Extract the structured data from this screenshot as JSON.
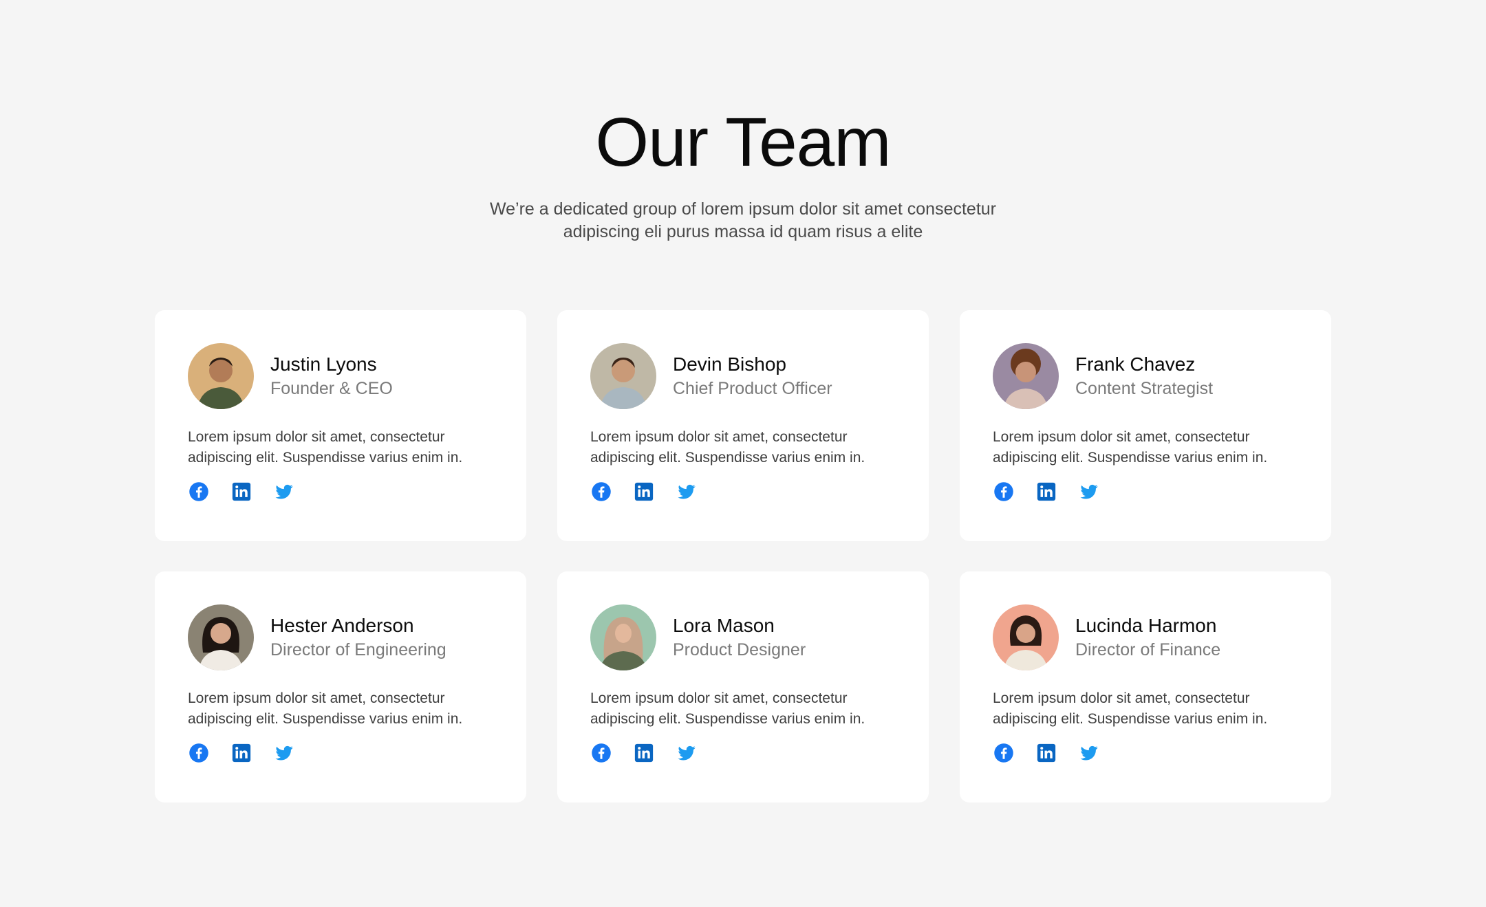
{
  "header": {
    "title": "Our Team",
    "subtitle_line1": "We’re a dedicated group of lorem ipsum dolor sit amet consectetur",
    "subtitle_line2": "adipiscing eli purus massa id quam risus a elite"
  },
  "colors": {
    "background": "#f5f5f5",
    "card": "#ffffff",
    "facebook": "#1877f2",
    "linkedin": "#0a66c2",
    "twitter": "#1d9bf0"
  },
  "members": [
    {
      "name": "Justin Lyons",
      "role": "Founder & CEO",
      "bio_line1": "Lorem ipsum dolor sit amet, consectetur",
      "bio_line2": "adipiscing elit. Suspendisse varius enim in.",
      "avatar_bg": "#d9b07a",
      "icons": [
        "facebook-icon",
        "linkedin-icon",
        "twitter-icon"
      ]
    },
    {
      "name": "Devin Bishop",
      "role": "Chief Product Officer",
      "bio_line1": "Lorem ipsum dolor sit amet, consectetur",
      "bio_line2": "adipiscing elit. Suspendisse varius enim in.",
      "avatar_bg": "#bfb8a6",
      "icons": [
        "facebook-icon",
        "linkedin-icon",
        "twitter-icon"
      ]
    },
    {
      "name": "Frank Chavez",
      "role": "Content Strategist",
      "bio_line1": "Lorem ipsum dolor sit amet, consectetur",
      "bio_line2": "adipiscing elit. Suspendisse varius enim in.",
      "avatar_bg": "#9a8aa2",
      "icons": [
        "facebook-icon",
        "linkedin-icon",
        "twitter-icon"
      ]
    },
    {
      "name": "Hester Anderson",
      "role": "Director of Engineering",
      "bio_line1": "Lorem ipsum dolor sit amet, consectetur",
      "bio_line2": "adipiscing elit. Suspendisse varius enim in.",
      "avatar_bg": "#8a8373",
      "icons": [
        "facebook-icon",
        "linkedin-icon",
        "twitter-icon"
      ]
    },
    {
      "name": "Lora Mason",
      "role": "Product Designer",
      "bio_line1": "Lorem ipsum dolor sit amet, consectetur",
      "bio_line2": "adipiscing elit. Suspendisse varius enim in.",
      "avatar_bg": "#9cc6ae",
      "icons": [
        "facebook-icon",
        "linkedin-icon",
        "twitter-icon"
      ]
    },
    {
      "name": "Lucinda Harmon",
      "role": "Director of Finance",
      "bio_line1": "Lorem ipsum dolor sit amet, consectetur",
      "bio_line2": "adipiscing elit. Suspendisse varius enim in.",
      "avatar_bg": "#f0a58e",
      "icons": [
        "facebook-icon",
        "linkedin-icon",
        "twitter-icon"
      ]
    }
  ]
}
